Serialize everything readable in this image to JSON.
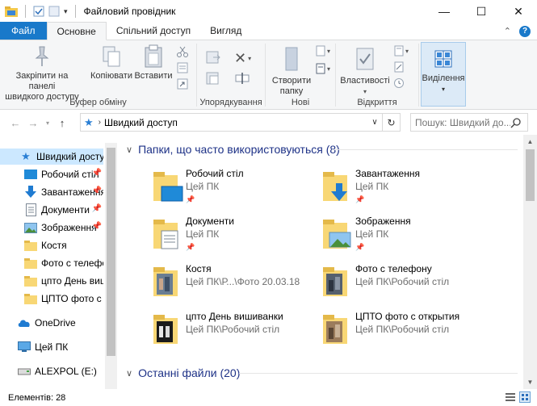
{
  "window": {
    "title": "Файловий провідник",
    "minimize": "—",
    "maximize": "☐",
    "close": "✕"
  },
  "ribbon_tabs": [
    {
      "label": "Файл"
    },
    {
      "label": "Основне"
    },
    {
      "label": "Спільний доступ"
    },
    {
      "label": "Вигляд"
    }
  ],
  "ribbon": {
    "pin_label_1": "Закріпити на панелі",
    "pin_label_2": "швидкого доступу",
    "copy_label": "Копіювати",
    "paste_label": "Вставити",
    "clipboard_group": "Буфер обміну",
    "organize_group": "Упорядкування",
    "new_folder_1": "Створити",
    "new_folder_2": "папку",
    "new_group": "Нові",
    "properties_label": "Властивості",
    "open_group": "Відкриття",
    "select_label": "Виділення"
  },
  "address": {
    "path": "Швидкий доступ",
    "search_placeholder": "Пошук: Швидкий до..."
  },
  "sidebar": {
    "items": [
      {
        "label": "Швидкий доступ"
      },
      {
        "label": "Робочий стіл"
      },
      {
        "label": "Завантаження"
      },
      {
        "label": "Документи"
      },
      {
        "label": "Зображення"
      },
      {
        "label": "Костя"
      },
      {
        "label": "Фото с телефону"
      },
      {
        "label": "цпто День вишиванки"
      },
      {
        "label": "ЦПТО фото с открытия"
      },
      {
        "label": "OneDrive"
      },
      {
        "label": "Цей ПК"
      },
      {
        "label": "ALEXPOL (E:)"
      }
    ]
  },
  "main": {
    "frequent_header": "Папки, що часто використовуються (8)",
    "recent_header": "Останні файли (20)",
    "tiles": [
      {
        "name": "Робочий стіл",
        "sub": "Цей ПК",
        "icon": "desktop-folder-icon"
      },
      {
        "name": "Завантаження",
        "sub": "Цей ПК",
        "icon": "downloads-folder-icon"
      },
      {
        "name": "Документи",
        "sub": "Цей ПК",
        "icon": "documents-folder-icon"
      },
      {
        "name": "Зображення",
        "sub": "Цей ПК",
        "icon": "pictures-folder-icon"
      },
      {
        "name": "Костя",
        "sub": "Цей ПК\\Р...\\Фото 20.03.18",
        "icon": "photo-folder-icon"
      },
      {
        "name": "Фото с телефону",
        "sub": "Цей ПК\\Робочий стіл",
        "icon": "photo-folder-icon"
      },
      {
        "name": "цпто День вишиванки",
        "sub": "Цей ПК\\Робочий стіл",
        "icon": "photo-folder-icon"
      },
      {
        "name": "ЦПТО фото с открытия",
        "sub": "Цей ПК\\Робочий стіл",
        "icon": "photo-folder-icon"
      }
    ]
  },
  "status": {
    "count": "Елементів: 28"
  },
  "colors": {
    "accent": "#1979ca",
    "header_text": "#1e3287",
    "selection": "#cce8ff",
    "folder": "#f8d775"
  }
}
